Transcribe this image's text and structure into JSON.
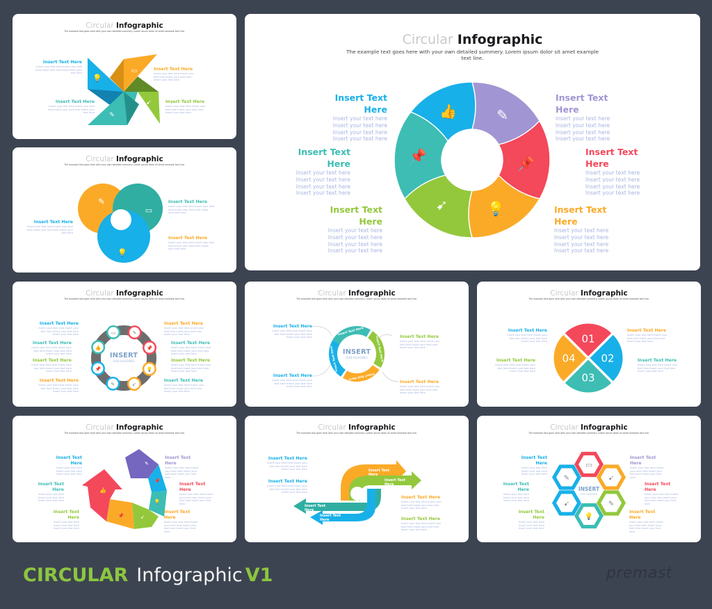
{
  "colors": {
    "background": "#3d4451",
    "blue": "#18b0e8",
    "purple": "#a295d3",
    "red": "#f4485b",
    "orange": "#fbaa28",
    "green": "#93c83c",
    "teal": "#3dbdb4",
    "violet": "#7566c0",
    "body_text": "#a7b4e0"
  },
  "slide_common": {
    "title_light": "Circular",
    "title_bold": "Infographic",
    "subtitle": "The example text goes here with your own detailed summery. Lorem ipsum dolor sit amet example text line."
  },
  "main_slide": {
    "left": [
      {
        "heading": "Insert Text Here",
        "body": [
          "Insert your text here",
          "Insert your text here",
          "Insert your text here",
          "Insert your text here"
        ],
        "color_key": "blue"
      },
      {
        "heading": "Insert Text Here",
        "body": [
          "Insert your text here",
          "Insert your text here",
          "Insert your text here",
          "Insert your text here"
        ],
        "color_key": "teal"
      },
      {
        "heading": "Insert Text Here",
        "body": [
          "Insert your text here",
          "Insert your text here",
          "Insert your text here",
          "Insert your text here"
        ],
        "color_key": "green"
      }
    ],
    "right": [
      {
        "heading": "Insert Text Here",
        "body": "Insert your text here Insert your text here Insert your text here Insert your text here",
        "color_key": "purple"
      },
      {
        "heading": "Insert Text Here",
        "body": "Insert your text here Insert your text here Insert your text here Insert your text here",
        "color_key": "red"
      },
      {
        "heading": "Insert Text Here",
        "body": "Insert your text here Insert your text here Insert your text here Insert your text here",
        "color_key": "orange"
      }
    ],
    "segments": [
      {
        "color_key": "blue",
        "icon": "thumbs-up-icon"
      },
      {
        "color_key": "purple",
        "icon": "pencil-icon"
      },
      {
        "color_key": "red",
        "icon": "pushpin-icon"
      },
      {
        "color_key": "orange",
        "icon": "lightbulb-icon"
      },
      {
        "color_key": "green",
        "icon": "rocket-icon"
      },
      {
        "color_key": "teal",
        "icon": "pushpin-icon"
      }
    ]
  },
  "small_text": {
    "heading": "Insert Text Here",
    "heading_line1": "Insert Text",
    "heading_line2": "Here",
    "body": "Insert your text here Insert your text here Insert your text here Insert your text here",
    "body_short": "Insert your text here Insert your text here Insert your text here"
  },
  "slide_pinwheel": {
    "labels": [
      {
        "color_key": "blue",
        "side": "left"
      },
      {
        "color_key": "orange",
        "side": "right"
      },
      {
        "color_key": "teal",
        "side": "left"
      },
      {
        "color_key": "green",
        "side": "right"
      }
    ]
  },
  "slide_rings": {
    "labels": [
      {
        "color_key": "teal"
      },
      {
        "color_key": "blue"
      },
      {
        "color_key": "orange"
      }
    ]
  },
  "slide_chain": {
    "center_title": "INSERT",
    "center_subtitle": "SUB-HEADING"
  },
  "slide_cycle": {
    "center_title": "INSERT",
    "center_subtitle": "SUB-HEADING",
    "arc_label": "Insert Text Here"
  },
  "slide_pie": {
    "numbers": [
      "01",
      "02",
      "03",
      "04"
    ]
  },
  "slide_arrows": {
    "arrow_label": "Insert Text Here"
  },
  "slide_hex": {
    "center_title": "INSERT",
    "center_subtitle": "SUB-HEADING"
  },
  "footer": {
    "title_accent": "CIRCULAR",
    "title_main": "Infographic",
    "version": "V1",
    "brand": "premast"
  }
}
